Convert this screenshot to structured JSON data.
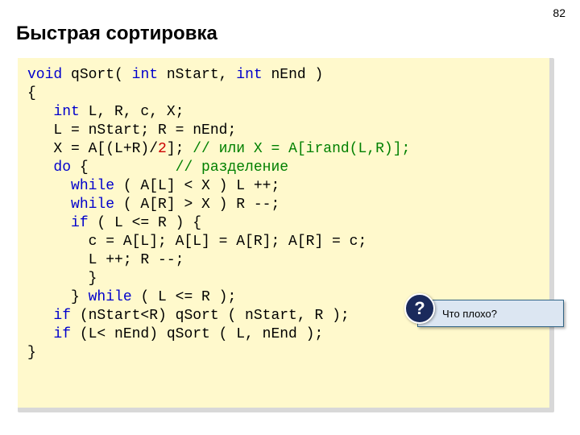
{
  "page_number": "82",
  "title": "Быстрая сортировка",
  "code": {
    "l1": {
      "a": "void",
      "b": " qSort( ",
      "c": "int",
      "d": " nStart, ",
      "e": "int",
      "f": " nEnd )"
    },
    "l2": "{",
    "l3": {
      "a": "int",
      "b": " L, R, c, X;"
    },
    "l4": "   L = nStart; R = nEnd;",
    "l5": {
      "a": "   X = A[(L+R)/",
      "b": "2",
      "c": "]; ",
      "d": "// или X = A[irand(L,R)];"
    },
    "l6": {
      "a": "do",
      "b": " {          ",
      "c": "// разделение"
    },
    "l7": {
      "a": "while",
      "b": " ( A[L] < X ) L ++;"
    },
    "l8": {
      "a": "while",
      "b": " ( A[R] > X ) R --;"
    },
    "l9": {
      "a": "if",
      "b": " ( L <= R ) {"
    },
    "l10": "       c = A[L]; A[L] = A[R]; A[R] = c;",
    "l11": "       L ++; R --;",
    "l12": "       }",
    "l13": {
      "a": "     } ",
      "b": "while",
      "c": " ( L <= R );"
    },
    "l14": {
      "a": "if",
      "b": " (nStart<R) qSort ( nStart, R );"
    },
    "l15": {
      "a": "if",
      "b": " (L< nEnd) qSort ( L, nEnd );"
    },
    "l16": "}"
  },
  "callout": {
    "badge": "?",
    "text": "Что плохо?"
  }
}
